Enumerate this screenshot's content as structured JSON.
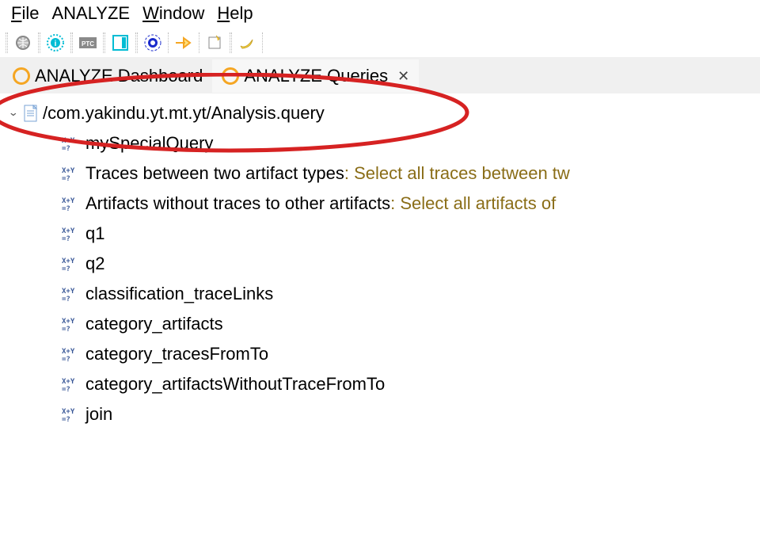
{
  "menu": {
    "file": "File",
    "analyze": "ANALYZE",
    "window": "Window",
    "help": "Help"
  },
  "tabs": [
    {
      "label": "ANALYZE Dashboard"
    },
    {
      "label": "ANALYZE Queries"
    }
  ],
  "tree": {
    "path": "/com.yakindu.yt.mt.yt/Analysis.query",
    "items": [
      {
        "name": "mySpecialQuery"
      },
      {
        "name": "Traces between two artifact types",
        "desc": " : Select all traces between tw"
      },
      {
        "name": "Artifacts without traces to other artifacts",
        "desc": " : Select all artifacts of "
      },
      {
        "name": "q1"
      },
      {
        "name": "q2"
      },
      {
        "name": "classification_traceLinks"
      },
      {
        "name": "category_artifacts"
      },
      {
        "name": "category_tracesFromTo"
      },
      {
        "name": "category_artifactsWithoutTraceFromTo"
      },
      {
        "name": "join"
      }
    ]
  }
}
